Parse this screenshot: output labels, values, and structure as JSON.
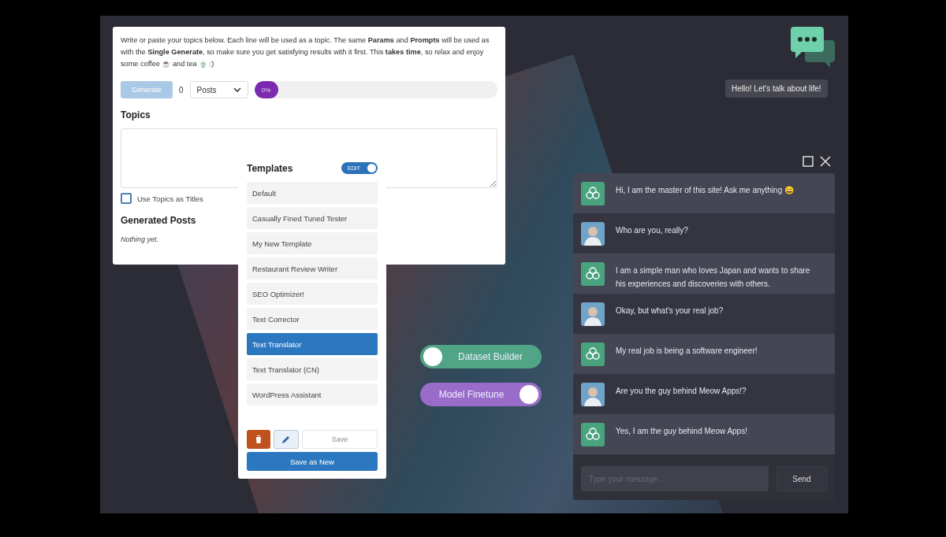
{
  "generator": {
    "intro": "Write or paste your topics below. Each line will be used as a topic. The same **Params** and **Prompts** will be used as with the **Single Generate**, so make sure you get satisfying results with it first. This **takes time**, so relax and enjoy some coffee ☕ and tea 🍵 :)",
    "generate_button": {
      "label": "Generate",
      "disabled": true
    },
    "count": "0",
    "unit_select": "Posts",
    "progress": {
      "label": "0%",
      "level": 0
    },
    "topics_heading": "Topics",
    "use_topics_as_titles": {
      "label": "Use Topics as Titles",
      "checked": false
    },
    "generated_heading": "Generated Posts",
    "empty_text": "Nothing yet."
  },
  "templates": {
    "title": "Templates",
    "edit_toggle": {
      "label": "EDIT",
      "on": true
    },
    "items": [
      {
        "label": "Default",
        "selected": false
      },
      {
        "label": "Casually Fined Tuned Tester",
        "selected": false
      },
      {
        "label": "My New Template",
        "selected": false
      },
      {
        "label": "Restaurant Review Writer",
        "selected": false
      },
      {
        "label": "SEO Optimizer!",
        "selected": false
      },
      {
        "label": "Text Corrector",
        "selected": false
      },
      {
        "label": "Text Translator",
        "selected": true
      },
      {
        "label": "Text Translator (CN)",
        "selected": false
      },
      {
        "label": "WordPress Assistant",
        "selected": false
      }
    ],
    "save_button": {
      "label": "Save",
      "disabled": true
    },
    "save_as_new": "Save as New"
  },
  "toggles": [
    {
      "label": "Dataset Builder",
      "on": false,
      "color": "#4fa585"
    },
    {
      "label": "Model Finetune",
      "on": true,
      "color": "#9a6cc9"
    }
  ],
  "chat": {
    "greeting": "Hello! Let's talk about life!",
    "messages": [
      {
        "kind": "ai",
        "text": "Hi, I am the master of this site! Ask me anything 😄"
      },
      {
        "kind": "user",
        "text": "Who are you, really?"
      },
      {
        "kind": "ai",
        "text": "I am a simple man who loves Japan and wants to share his experiences and discoveries with others."
      },
      {
        "kind": "user",
        "text": "Okay, but what's your real job?"
      },
      {
        "kind": "ai",
        "text": "My real job is being a software engineer!"
      },
      {
        "kind": "user",
        "text": "Are you the guy behind Meow Apps!?"
      },
      {
        "kind": "ai",
        "text": "Yes, I am the guy behind Meow Apps!"
      }
    ],
    "input_placeholder": "Type your message...",
    "send_button": "Send"
  }
}
